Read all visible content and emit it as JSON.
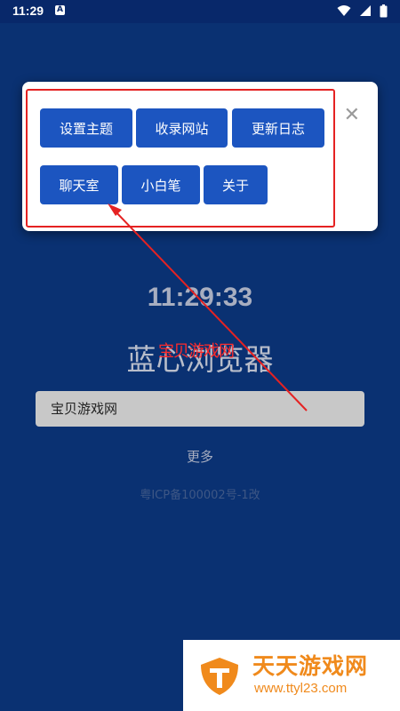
{
  "status_bar": {
    "time": "11:29",
    "notification_icon": "A",
    "icons": [
      "wifi-icon",
      "signal-icon",
      "battery-icon"
    ]
  },
  "popup": {
    "buttons": {
      "theme": "设置主题",
      "collect": "收录网站",
      "log": "更新日志",
      "chat": "聊天室",
      "note": "小白笔",
      "about": "关于"
    },
    "close_symbol": "✕"
  },
  "main": {
    "clock": "11:29:33",
    "app_title": "蓝心浏览器",
    "overlay_text": "宝贝游戏网",
    "search_placeholder": "宝贝游戏网",
    "more_label": "更多",
    "icp": "粤ICP备100002号-1改"
  },
  "watermark": {
    "name": "天天游戏网",
    "url": "www.ttyl23.com"
  },
  "colors": {
    "background": "#0a3172",
    "button": "#1c55c0",
    "highlight": "#e52222",
    "watermark": "#f08a1c"
  }
}
